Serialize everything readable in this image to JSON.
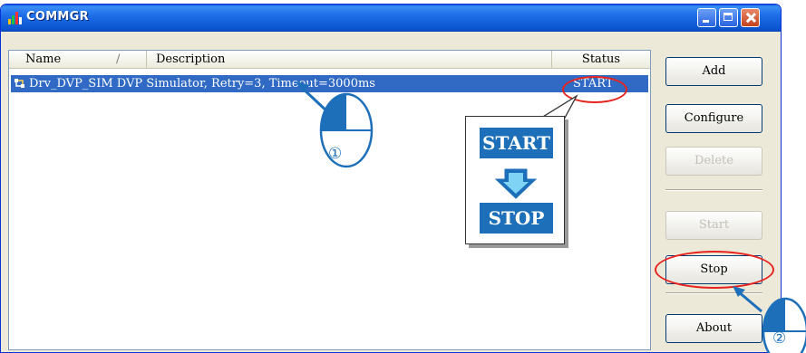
{
  "window": {
    "title": "COMMGR"
  },
  "list": {
    "columns": {
      "name": "Name",
      "sort_indicator": "/",
      "description": "Description",
      "status": "Status"
    },
    "rows": [
      {
        "text": "Drv_DVP_SIM DVP Simulator, Retry=3, Timeout=3000ms",
        "status": "START"
      }
    ]
  },
  "buttons": {
    "add": "Add",
    "configure": "Configure",
    "delete": "Delete",
    "start": "Start",
    "stop": "Stop",
    "about": "About"
  },
  "annotations": {
    "popup_from": "START",
    "popup_to": "STOP",
    "step1": "①",
    "step2": "②"
  },
  "colors": {
    "selection": "#316ac5",
    "highlight_ellipse": "#e8231e",
    "label_blue": "#1c6fb8"
  },
  "icons": [
    "app-icon",
    "driver-icon",
    "mouse-icon",
    "down-arrow-icon",
    "minimize-icon",
    "maximize-icon",
    "close-icon"
  ]
}
